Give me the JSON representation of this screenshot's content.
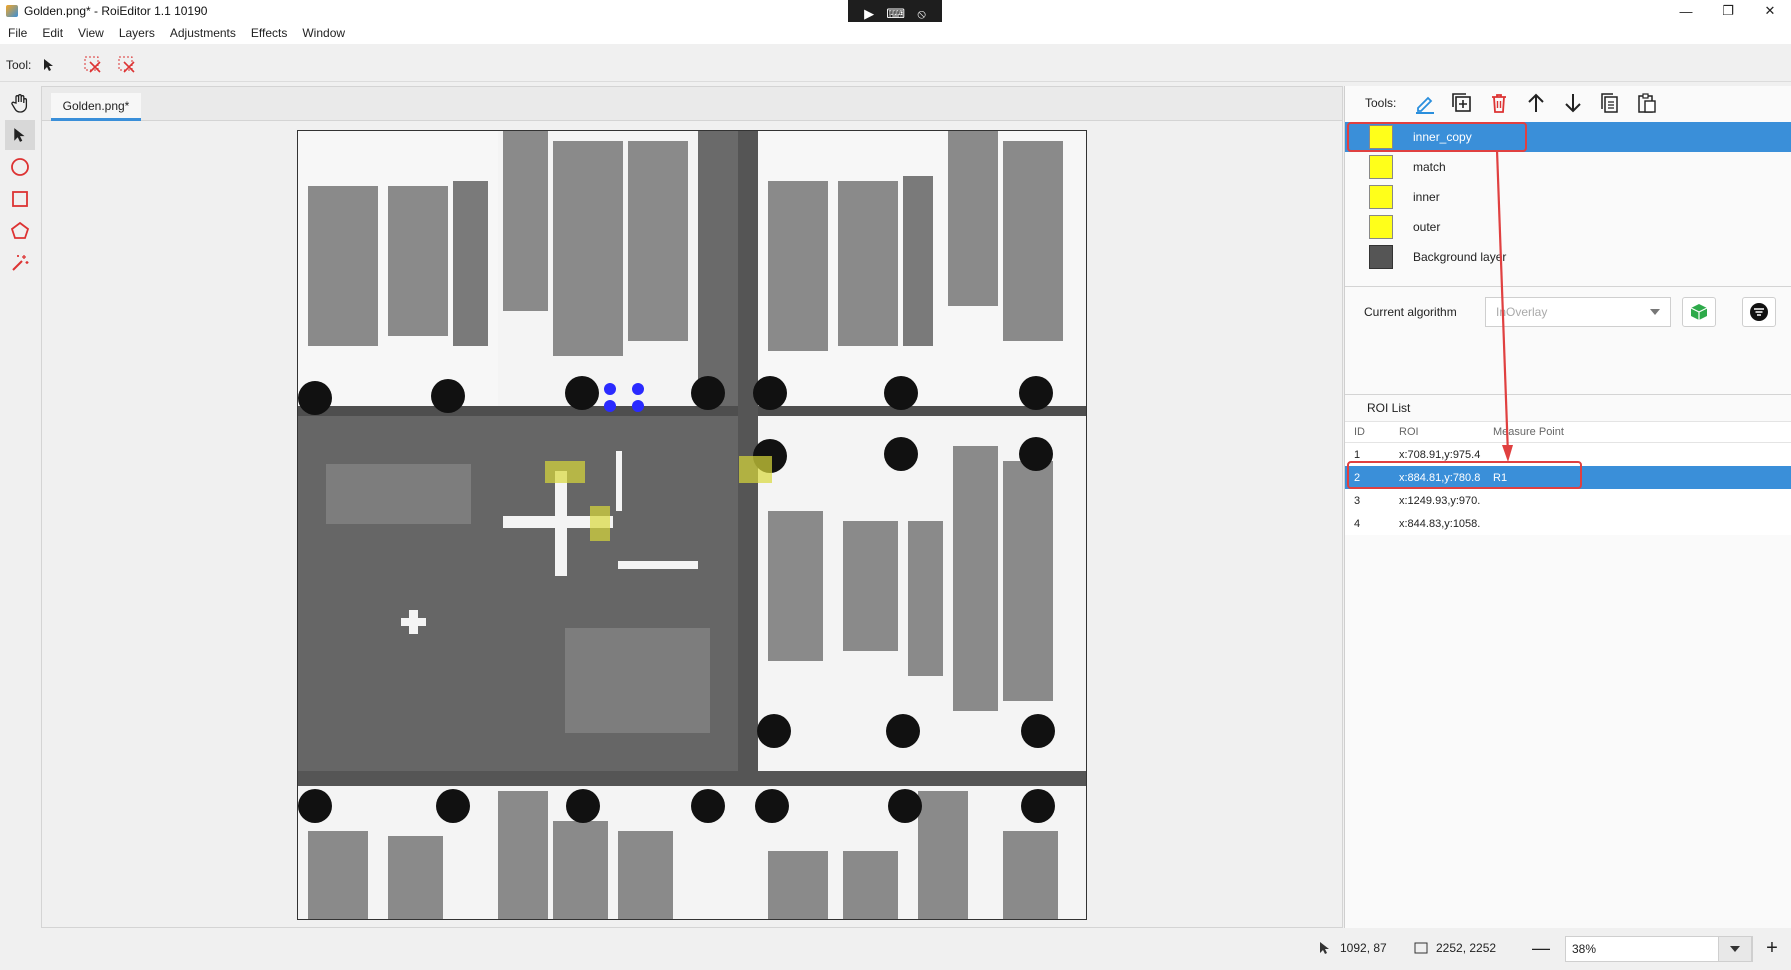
{
  "window": {
    "title": "Golden.png* - RoiEditor 1.1 10190"
  },
  "menu": [
    "File",
    "Edit",
    "View",
    "Layers",
    "Adjustments",
    "Effects",
    "Window"
  ],
  "toolbar": {
    "tool_label": "Tool:"
  },
  "tabs": [
    {
      "label": "Golden.png*"
    }
  ],
  "right_panel": {
    "tools_label": "Tools:",
    "layers": [
      {
        "name": "inner_copy",
        "color": "#ffff1a",
        "selected": true
      },
      {
        "name": "match",
        "color": "#ffff1a",
        "selected": false
      },
      {
        "name": "inner",
        "color": "#ffff1a",
        "selected": false
      },
      {
        "name": "outer",
        "color": "#ffff1a",
        "selected": false
      },
      {
        "name": "Background layer",
        "selected": false
      }
    ],
    "current_algorithm_label": "Current algorithm",
    "current_algorithm_value": "InOverlay",
    "roi_list": {
      "title": "ROI List",
      "headers": [
        "ID",
        "ROI",
        "Measure Point"
      ],
      "rows": [
        {
          "id": "1",
          "roi": "x:708.91,y:975.4",
          "mp": "",
          "selected": false
        },
        {
          "id": "2",
          "roi": "x:884.81,y:780.8",
          "mp": "R1",
          "selected": true
        },
        {
          "id": "3",
          "roi": "x:1249.93,y:970.",
          "mp": "",
          "selected": false
        },
        {
          "id": "4",
          "roi": "x:844.83,y:1058.",
          "mp": "",
          "selected": false
        }
      ]
    }
  },
  "status": {
    "cursor_pos": "1092, 87",
    "image_size": "2252, 2252",
    "zoom": "38%"
  },
  "colors": {
    "accent": "#3a8fd9",
    "highlight": "#e04040",
    "roi_yellow": "#ffff1a"
  }
}
